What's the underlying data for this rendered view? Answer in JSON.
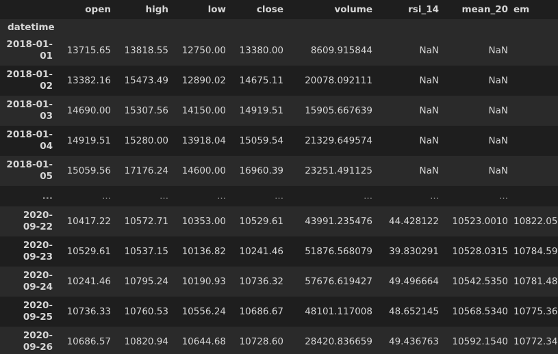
{
  "columns": [
    "open",
    "high",
    "low",
    "close",
    "volume",
    "rsi_14",
    "mean_20",
    "em"
  ],
  "index_name": "datetime",
  "rows_top": [
    {
      "date_a": "2018-01-",
      "date_b": "01",
      "open": "13715.65",
      "high": "13818.55",
      "low": "12750.00",
      "close": "13380.00",
      "volume": "8609.915844",
      "rsi_14": "NaN",
      "mean_20": "NaN",
      "em": ""
    },
    {
      "date_a": "2018-01-",
      "date_b": "02",
      "open": "13382.16",
      "high": "15473.49",
      "low": "12890.02",
      "close": "14675.11",
      "volume": "20078.092111",
      "rsi_14": "NaN",
      "mean_20": "NaN",
      "em": ""
    },
    {
      "date_a": "2018-01-",
      "date_b": "03",
      "open": "14690.00",
      "high": "15307.56",
      "low": "14150.00",
      "close": "14919.51",
      "volume": "15905.667639",
      "rsi_14": "NaN",
      "mean_20": "NaN",
      "em": ""
    },
    {
      "date_a": "2018-01-",
      "date_b": "04",
      "open": "14919.51",
      "high": "15280.00",
      "low": "13918.04",
      "close": "15059.54",
      "volume": "21329.649574",
      "rsi_14": "NaN",
      "mean_20": "NaN",
      "em": ""
    },
    {
      "date_a": "2018-01-",
      "date_b": "05",
      "open": "15059.56",
      "high": "17176.24",
      "low": "14600.00",
      "close": "16960.39",
      "volume": "23251.491125",
      "rsi_14": "NaN",
      "mean_20": "NaN",
      "em": ""
    }
  ],
  "ellipsis": "...",
  "rows_bottom": [
    {
      "date_a": "2020-",
      "date_b": "09-22",
      "open": "10417.22",
      "high": "10572.71",
      "low": "10353.00",
      "close": "10529.61",
      "volume": "43991.235476",
      "rsi_14": "44.428122",
      "mean_20": "10523.0010",
      "em": "10822.05"
    },
    {
      "date_a": "2020-",
      "date_b": "09-23",
      "open": "10529.61",
      "high": "10537.15",
      "low": "10136.82",
      "close": "10241.46",
      "volume": "51876.568079",
      "rsi_14": "39.830291",
      "mean_20": "10528.0315",
      "em": "10784.59"
    },
    {
      "date_a": "2020-",
      "date_b": "09-24",
      "open": "10241.46",
      "high": "10795.24",
      "low": "10190.93",
      "close": "10736.32",
      "volume": "57676.619427",
      "rsi_14": "49.496664",
      "mean_20": "10542.5350",
      "em": "10781.48"
    },
    {
      "date_a": "2020-",
      "date_b": "09-25",
      "open": "10736.33",
      "high": "10760.53",
      "low": "10556.24",
      "close": "10686.67",
      "volume": "48101.117008",
      "rsi_14": "48.652145",
      "mean_20": "10568.5340",
      "em": "10775.36"
    },
    {
      "date_a": "2020-",
      "date_b": "09-26",
      "open": "10686.57",
      "high": "10820.94",
      "low": "10644.68",
      "close": "10728.60",
      "volume": "28420.836659",
      "rsi_14": "49.436763",
      "mean_20": "10592.1540",
      "em": "10772.34"
    }
  ]
}
